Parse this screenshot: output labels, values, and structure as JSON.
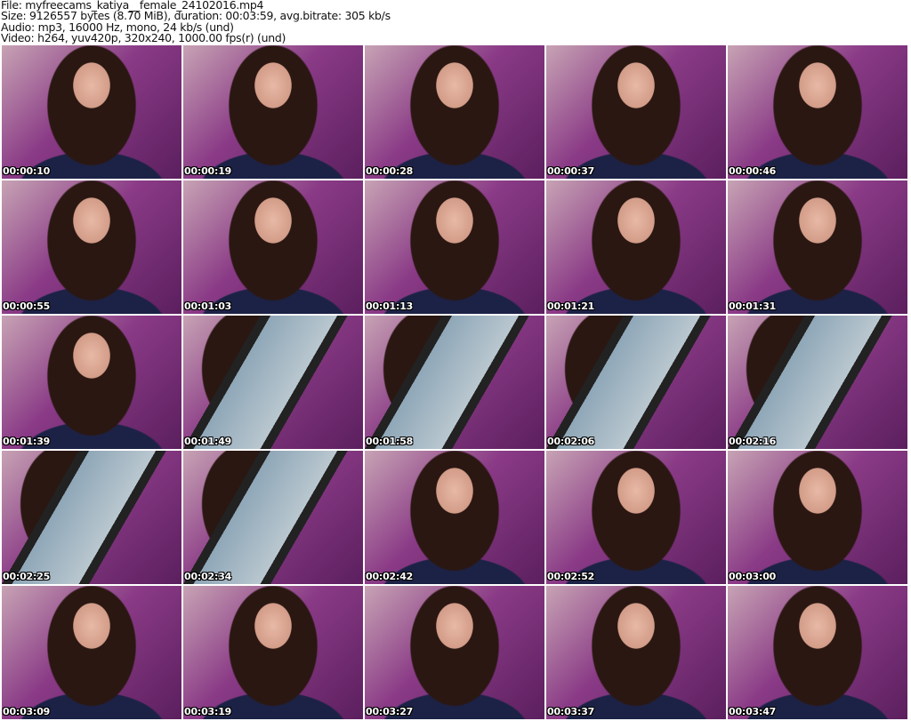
{
  "header": {
    "file": "File: myfreecams_katiya__female_24102016.mp4",
    "size": "Size: 9126557 bytes (8.70 MiB), duration: 00:03:59, avg.bitrate: 305 kb/s",
    "audio": "Audio: mp3, 16000 Hz, mono, 24 kb/s (und)",
    "video": "Video: h264, yuv420p, 320x240, 1000.00 fps(r) (und)"
  },
  "thumbnails": [
    {
      "timestamp": "00:00:10",
      "icon": "video-frame"
    },
    {
      "timestamp": "00:00:19",
      "icon": "video-frame"
    },
    {
      "timestamp": "00:00:28",
      "icon": "video-frame"
    },
    {
      "timestamp": "00:00:37",
      "icon": "video-frame"
    },
    {
      "timestamp": "00:00:46",
      "icon": "video-frame"
    },
    {
      "timestamp": "00:00:55",
      "icon": "video-frame"
    },
    {
      "timestamp": "00:01:03",
      "icon": "video-frame"
    },
    {
      "timestamp": "00:01:13",
      "icon": "video-frame"
    },
    {
      "timestamp": "00:01:21",
      "icon": "video-frame"
    },
    {
      "timestamp": "00:01:31",
      "icon": "video-frame"
    },
    {
      "timestamp": "00:01:39",
      "icon": "video-frame"
    },
    {
      "timestamp": "00:01:49",
      "icon": "phone-frame"
    },
    {
      "timestamp": "00:01:58",
      "icon": "phone-frame"
    },
    {
      "timestamp": "00:02:06",
      "icon": "phone-frame"
    },
    {
      "timestamp": "00:02:16",
      "icon": "phone-frame"
    },
    {
      "timestamp": "00:02:25",
      "icon": "phone-frame"
    },
    {
      "timestamp": "00:02:34",
      "icon": "phone-frame"
    },
    {
      "timestamp": "00:02:42",
      "icon": "video-frame"
    },
    {
      "timestamp": "00:02:52",
      "icon": "video-frame"
    },
    {
      "timestamp": "00:03:00",
      "icon": "video-frame"
    },
    {
      "timestamp": "00:03:09",
      "icon": "video-frame"
    },
    {
      "timestamp": "00:03:19",
      "icon": "video-frame"
    },
    {
      "timestamp": "00:03:27",
      "icon": "video-frame"
    },
    {
      "timestamp": "00:03:37",
      "icon": "video-frame"
    },
    {
      "timestamp": "00:03:47",
      "icon": "video-frame"
    }
  ]
}
